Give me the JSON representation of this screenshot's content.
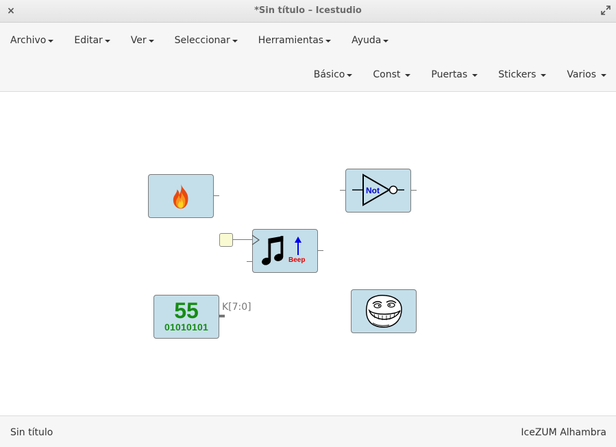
{
  "window": {
    "title": "*Sin título – Icestudio",
    "close_glyph": "×"
  },
  "menubar": {
    "primary": [
      {
        "label": "Archivo"
      },
      {
        "label": "Editar"
      },
      {
        "label": "Ver"
      },
      {
        "label": "Seleccionar"
      },
      {
        "label": "Herramientas"
      },
      {
        "label": "Ayuda"
      }
    ],
    "secondary": [
      {
        "label": "Básico"
      },
      {
        "label": "Const"
      },
      {
        "label": "Puertas"
      },
      {
        "label": "Stickers"
      },
      {
        "label": "Varios"
      }
    ]
  },
  "canvas": {
    "blocks": {
      "fire": {
        "icon": "fire-icon"
      },
      "not_gate": {
        "label": "Not",
        "icon": "not-gate-icon"
      },
      "beep": {
        "label": "Beep",
        "icon": "music-note-icon"
      },
      "constant": {
        "value": "55",
        "binary": "01010101",
        "output_label": "K[7:0]"
      },
      "troll": {
        "icon": "troll-face-icon"
      }
    },
    "colors": {
      "block_fill": "#c4dfea",
      "constant_green": "#178c14",
      "not_label_blue": "#0000cc",
      "beep_red": "#e00000"
    }
  },
  "statusbar": {
    "left": "Sin título",
    "right": "IceZUM Alhambra"
  }
}
